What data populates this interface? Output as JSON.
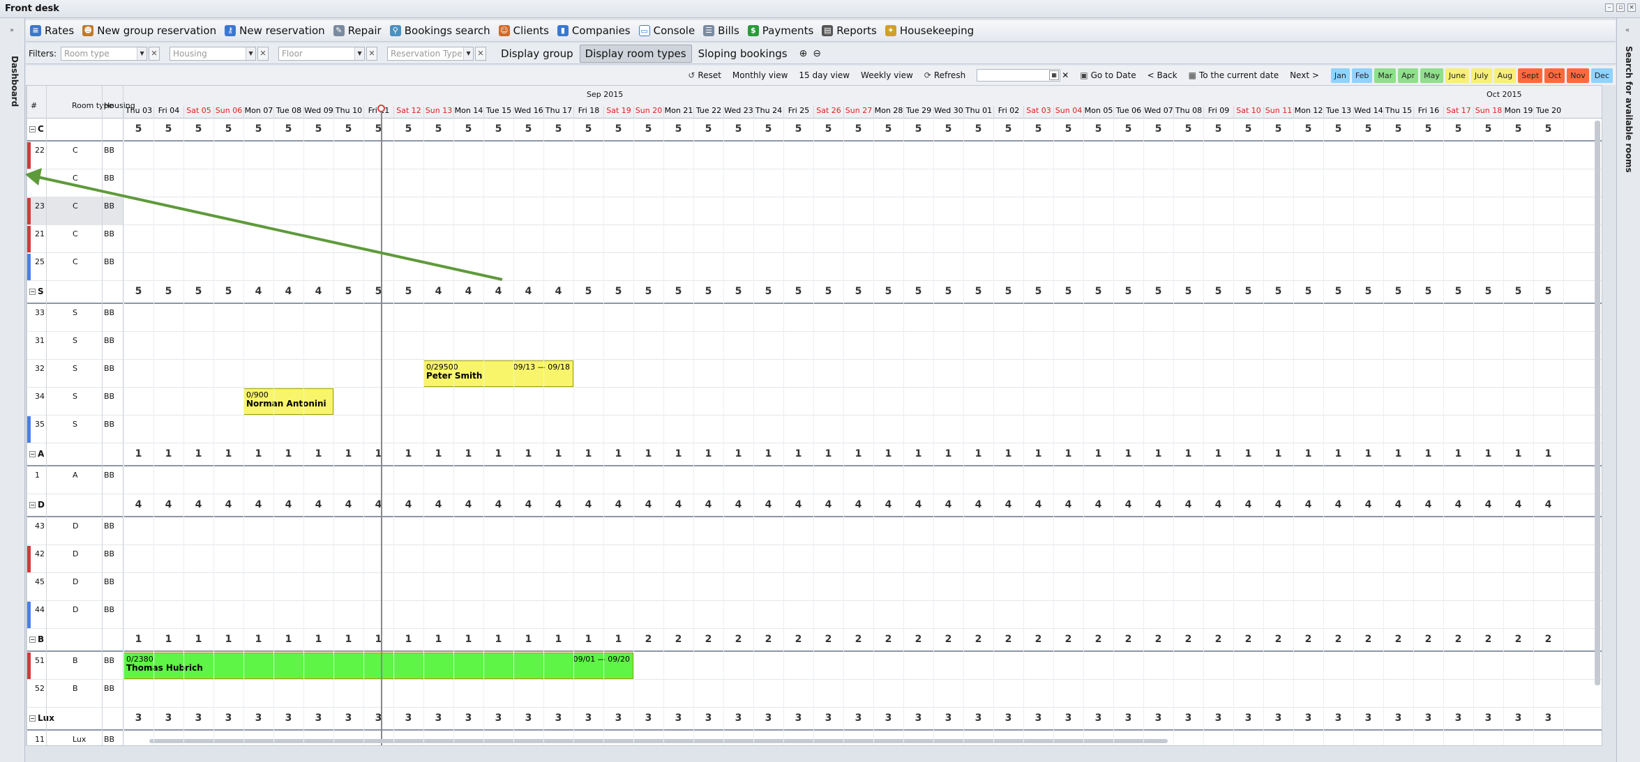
{
  "window": {
    "title": "Front desk"
  },
  "side": {
    "left_label": "Dashboard",
    "right_label": "Search for available rooms"
  },
  "menu": [
    "Rates",
    "New group reservation",
    "New reservation",
    "Repair",
    "Bookings search",
    "Clients",
    "Companies",
    "Console",
    "Bills",
    "Payments",
    "Reports",
    "Housekeeping"
  ],
  "filters": {
    "label": "Filters:",
    "room_type": "Room type",
    "housing": "Housing",
    "floor": "Floor",
    "reservation_type": "Reservation Type",
    "display_group": "Display group",
    "display_room_types": "Display room types",
    "sloping": "Sloping bookings"
  },
  "toolbar": {
    "reset": "Reset",
    "monthly": "Monthly view",
    "fifteen": "15 day view",
    "weekly": "Weekly view",
    "refresh": "Refresh",
    "goto": "Go to Date",
    "back": "< Back",
    "current": "To the current date",
    "next": "Next >"
  },
  "months": [
    {
      "label": "Jan",
      "color": "#8fd3ff"
    },
    {
      "label": "Feb",
      "color": "#8fd3ff"
    },
    {
      "label": "Mar",
      "color": "#8fe08a"
    },
    {
      "label": "Apr",
      "color": "#8fe08a"
    },
    {
      "label": "May",
      "color": "#8fe08a"
    },
    {
      "label": "June",
      "color": "#f7ef7a"
    },
    {
      "label": "July",
      "color": "#f7ef7a"
    },
    {
      "label": "Aug",
      "color": "#f7ef7a"
    },
    {
      "label": "Sept",
      "color": "#ff6a3d"
    },
    {
      "label": "Oct",
      "color": "#ff6a3d"
    },
    {
      "label": "Nov",
      "color": "#ff6a3d"
    },
    {
      "label": "Dec",
      "color": "#8fd3ff"
    }
  ],
  "columns": {
    "num": "#",
    "type": "Room type",
    "housing": "Housing"
  },
  "month_titles": [
    "Sep 2015",
    "Oct 2015"
  ],
  "days": [
    "Thu 03",
    "Fri 04",
    "Sat 05",
    "Sun 06",
    "Mon 07",
    "Tue 08",
    "Wed 09",
    "Thu 10",
    "Fri 11",
    "Sat 12",
    "Sun 13",
    "Mon 14",
    "Tue 15",
    "Wed 16",
    "Thu 17",
    "Fri 18",
    "Sat 19",
    "Sun 20",
    "Mon 21",
    "Tue 22",
    "Wed 23",
    "Thu 24",
    "Fri 25",
    "Sat 26",
    "Sun 27",
    "Mon 28",
    "Tue 29",
    "Wed 30",
    "Thu 01",
    "Fri 02",
    "Sat 03",
    "Sun 04",
    "Mon 05",
    "Tue 06",
    "Wed 07",
    "Thu 08",
    "Fri 09",
    "Sat 10",
    "Sun 11",
    "Mon 12",
    "Tue 13",
    "Wed 14",
    "Thu 15",
    "Fri 16",
    "Sat 17",
    "Sun 18",
    "Mon 19",
    "Tue 20"
  ],
  "groups": [
    {
      "name": "C",
      "counts": "5 5 5 5 5 5 5 5 5 5 5 5 5 5 5 5 5 5 5 5 5 5 5 5 5 5 5 5 5 5 5 5 5 5 5 5 5 5 5 5 5 5 5 5 5 5 5 5",
      "rooms": [
        {
          "n": "22",
          "t": "C",
          "h": "BB",
          "c": "#d03a3a"
        },
        {
          "n": "",
          "t": "C",
          "h": "BB",
          "c": ""
        },
        {
          "n": "23",
          "t": "C",
          "h": "BB",
          "c": "#d03a3a"
        },
        {
          "n": "21",
          "t": "C",
          "h": "BB",
          "c": "#d03a3a"
        },
        {
          "n": "25",
          "t": "C",
          "h": "BB",
          "c": "#4a7fe0"
        }
      ]
    },
    {
      "name": "S",
      "counts": "5 5 5 5 4 4 4 5 5 5 4 4 4 4 4 5 5 5 5 5 5 5 5 5 5 5 5 5 5 5 5 5 5 5 5 5 5 5 5 5 5 5 5 5 5 5 5 5",
      "rooms": [
        {
          "n": "33",
          "t": "S",
          "h": "BB",
          "c": ""
        },
        {
          "n": "31",
          "t": "S",
          "h": "BB",
          "c": ""
        },
        {
          "n": "32",
          "t": "S",
          "h": "BB",
          "c": ""
        },
        {
          "n": "34",
          "t": "S",
          "h": "BB",
          "c": ""
        },
        {
          "n": "35",
          "t": "S",
          "h": "BB",
          "c": "#4a7fe0"
        }
      ]
    },
    {
      "name": "A",
      "counts": "1 1 1 1 1 1 1 1 1 1 1 1 1 1 1 1 1 1 1 1 1 1 1 1 1 1 1 1 1 1 1 1 1 1 1 1 1 1 1 1 1 1 1 1 1 1 1 1",
      "rooms": [
        {
          "n": "1",
          "t": "A",
          "h": "BB",
          "c": ""
        }
      ]
    },
    {
      "name": "D",
      "counts": "4 4 4 4 4 4 4 4 4 4 4 4 4 4 4 4 4 4 4 4 4 4 4 4 4 4 4 4 4 4 4 4 4 4 4 4 4 4 4 4 4 4 4 4 4 4 4 4",
      "rooms": [
        {
          "n": "43",
          "t": "D",
          "h": "BB",
          "c": ""
        },
        {
          "n": "42",
          "t": "D",
          "h": "BB",
          "c": "#d03a3a"
        },
        {
          "n": "45",
          "t": "D",
          "h": "BB",
          "c": ""
        },
        {
          "n": "44",
          "t": "D",
          "h": "BB",
          "c": "#4a7fe0"
        }
      ]
    },
    {
      "name": "B",
      "counts": "1 1 1 1 1 1 1 1 1 1 1 1 1 1 1 1 1 2 2 2 2 2 2 2 2 2 2 2 2 2 2 2 2 2 2 2 2 2 2 2 2 2 2 2 2 2 2 2",
      "rooms": [
        {
          "n": "51",
          "t": "B",
          "h": "BB",
          "c": "#d03a3a"
        },
        {
          "n": "52",
          "t": "B",
          "h": "BB",
          "c": ""
        }
      ]
    },
    {
      "name": "Lux",
      "counts": "3 3 3 3 3 3 3 3 3 3 3 3 3 3 3 3 3 3 3 3 3 3 3 3 3 3 3 3 3 3 3 3 3 3 3 3 3 3 3 3 3 3 3 3 3 3 3 3",
      "rooms": [
        {
          "n": "11",
          "t": "Lux",
          "h": "BB",
          "c": ""
        }
      ]
    }
  ],
  "bookings": [
    {
      "room": "32",
      "ref": "0/29500",
      "name": "Peter Smith",
      "dates": "09/13 — 09/18",
      "start": 10,
      "end": 15,
      "color": "#f9f56a"
    },
    {
      "room": "34",
      "ref": "0/900",
      "name": "Norman Antonini",
      "dates": "",
      "start": 4,
      "end": 7,
      "color": "#f9f56a"
    },
    {
      "room": "51",
      "ref": "0/2380",
      "name": "Thomas Hubrich",
      "dates": "09/01 — 09/20",
      "start": 0,
      "end": 17,
      "color": "#5ef546"
    }
  ]
}
